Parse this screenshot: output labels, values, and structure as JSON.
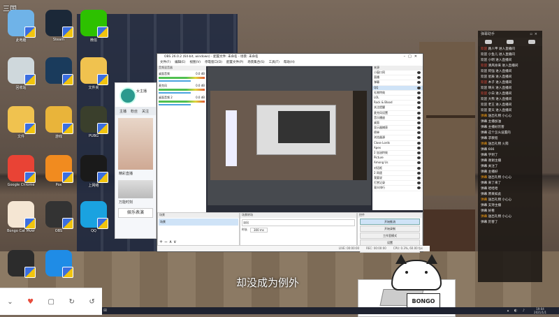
{
  "desktop": {
    "corner_label": "三国",
    "icons": [
      {
        "label": "此电脑",
        "color": "#6fb3e8",
        "name": "computer"
      },
      {
        "label": "Steam",
        "color": "#1b2838",
        "name": "steam"
      },
      {
        "label": "微信",
        "color": "#2dc100",
        "name": "wechat"
      },
      {
        "label": "回收站",
        "color": "#cfd8dc",
        "name": "recycle"
      },
      {
        "label": "",
        "color": "#1a3b5c",
        "name": "app-clock"
      },
      {
        "label": "文件夹",
        "color": "#f0c24f",
        "name": "folder"
      },
      {
        "label": "文件",
        "color": "#f0c24f",
        "name": "file"
      },
      {
        "label": "游戏",
        "color": "#e9b43a",
        "name": "game-fox"
      },
      {
        "label": "PUBG",
        "color": "#3a3f2c",
        "name": "pubg"
      },
      {
        "label": "Google Chrome",
        "color": "#e94335",
        "name": "chrome"
      },
      {
        "label": "Pox",
        "color": "#f18b1f",
        "name": "pox"
      },
      {
        "label": "上网络",
        "color": "#1a1a1a",
        "name": "app-v"
      },
      {
        "label": "Bongo Cat Mver",
        "color": "#f5e6d3",
        "name": "bongo-cat"
      },
      {
        "label": "OBS",
        "color": "#333",
        "name": "obs"
      },
      {
        "label": "QQ",
        "color": "#1aa2e0",
        "name": "qq"
      },
      {
        "label": "",
        "color": "#2c2c2c",
        "name": "app-bottom"
      },
      {
        "label": "",
        "color": "#1f8ce6",
        "name": "app-blue-f"
      }
    ]
  },
  "live_panel": {
    "tabs": [
      "主播",
      "粉丝",
      "关注"
    ],
    "name_line": "女主播",
    "row1": "精彩直播",
    "row2": "万能时刻",
    "button": "娱乐表演"
  },
  "obs": {
    "title": "OBS 26.0.2 (64-bit, windows) - 配置文件: 未命名 - 场景: 未命名",
    "menu": [
      "文件(F)",
      "编辑(E)",
      "视图(V)",
      "停靠窗口(D)",
      "配置文件(P)",
      "场景集合(S)",
      "工具(T)",
      "帮助(H)"
    ],
    "mixer_title": "音频混音器",
    "mixer_rows": [
      {
        "name": "桌面音频",
        "db": "0.0 dB"
      },
      {
        "name": "麦克风",
        "db": "0.0 dB"
      },
      {
        "name": "桌面音频 2",
        "db": "0.0 dB"
      }
    ],
    "sources_title": "来源",
    "sources": [
      "小窗口同",
      "直播",
      "弹幕",
      "QQ",
      "礼物特效",
      "LOL",
      "Rock & Blood",
      "关注提醒",
      "麦克风设置",
      "音乐播放",
      "桌面",
      "显示器捕获",
      "榜单",
      "浏览器源",
      "Close Lords",
      "Apex",
      "2 加油特效",
      "Picture",
      "Among Us",
      "对话框",
      "2 网速",
      "我要说",
      "打赏记录",
      "观众排行"
    ],
    "scenes_title": "场景",
    "scene_name": "场景",
    "transition_title": "场景转场",
    "transition_value": "淡出",
    "duration_label": "时长",
    "duration_value": "300 ms",
    "controls_title": "控件",
    "controls": [
      "开始推流",
      "开始录制",
      "工作室模式",
      "设置",
      "退出"
    ],
    "status": [
      "LIVE: 00:00:00",
      "REC: 00:00:00",
      "CPU: 0.3%, 60.00 fps"
    ]
  },
  "chat": {
    "title": "弹幕助手",
    "lines": [
      {
        "u": "欢迎",
        "t": "路人甲 进入直播间",
        "c": "r"
      },
      {
        "u": "欢迎",
        "t": "小鱼儿 进入直播间",
        "c": ""
      },
      {
        "u": "欢迎",
        "t": "小明 进入直播间",
        "c": ""
      },
      {
        "u": "欢迎",
        "t": "清风徐来 进入直播间",
        "c": "r"
      },
      {
        "u": "欢迎",
        "t": "阿强 进入直播间",
        "c": ""
      },
      {
        "u": "欢迎",
        "t": "星辰 进入直播间",
        "c": ""
      },
      {
        "u": "欢迎",
        "t": "木子 进入直播间",
        "c": "r"
      },
      {
        "u": "欢迎",
        "t": "晴天 进入直播间",
        "c": ""
      },
      {
        "u": "欢迎",
        "t": "小白 进入直播间",
        "c": "r"
      },
      {
        "u": "欢迎",
        "t": "大熊 进入直播间",
        "c": ""
      },
      {
        "u": "欢迎",
        "t": "老王 进入直播间",
        "c": ""
      },
      {
        "u": "欢迎",
        "t": "夏天 进入直播间",
        "c": ""
      },
      {
        "u": "弹幕",
        "t": "送出礼物 小心心",
        "c": "o"
      },
      {
        "u": "弹幕",
        "t": "主播加油",
        "c": ""
      },
      {
        "u": "弹幕",
        "t": "主播好厉害",
        "c": ""
      },
      {
        "u": "弹幕",
        "t": "这个怎么设置的",
        "c": ""
      },
      {
        "u": "弹幕",
        "t": "求教程",
        "c": ""
      },
      {
        "u": "弹幕",
        "t": "送出礼物 火箭",
        "c": "o"
      },
      {
        "u": "弹幕",
        "t": "666",
        "c": ""
      },
      {
        "u": "弹幕",
        "t": "学到了",
        "c": ""
      },
      {
        "u": "弹幕",
        "t": "谢谢主播",
        "c": ""
      },
      {
        "u": "弹幕",
        "t": "关注了",
        "c": ""
      },
      {
        "u": "弹幕",
        "t": "主播好",
        "c": ""
      },
      {
        "u": "弹幕",
        "t": "送出礼物 小心心",
        "c": "o"
      },
      {
        "u": "弹幕",
        "t": "来了来了",
        "c": ""
      },
      {
        "u": "弹幕",
        "t": "哈哈哈",
        "c": ""
      },
      {
        "u": "弹幕",
        "t": "原来如此",
        "c": ""
      },
      {
        "u": "弹幕",
        "t": "送出礼物 小心心",
        "c": "o"
      },
      {
        "u": "弹幕",
        "t": "支持主播",
        "c": ""
      },
      {
        "u": "弹幕",
        "t": "好看",
        "c": ""
      },
      {
        "u": "弹幕",
        "t": "送出礼物 小心心",
        "c": "o"
      },
      {
        "u": "弹幕",
        "t": "厉害了",
        "c": ""
      }
    ]
  },
  "subtitle": "却没成为例外",
  "cat_logo": "BONGO",
  "toolbar": [
    "⌄",
    "♥",
    "▢",
    "↻",
    "↺"
  ],
  "taskbar": {
    "time": "19:04",
    "date": "2021/1/1"
  }
}
